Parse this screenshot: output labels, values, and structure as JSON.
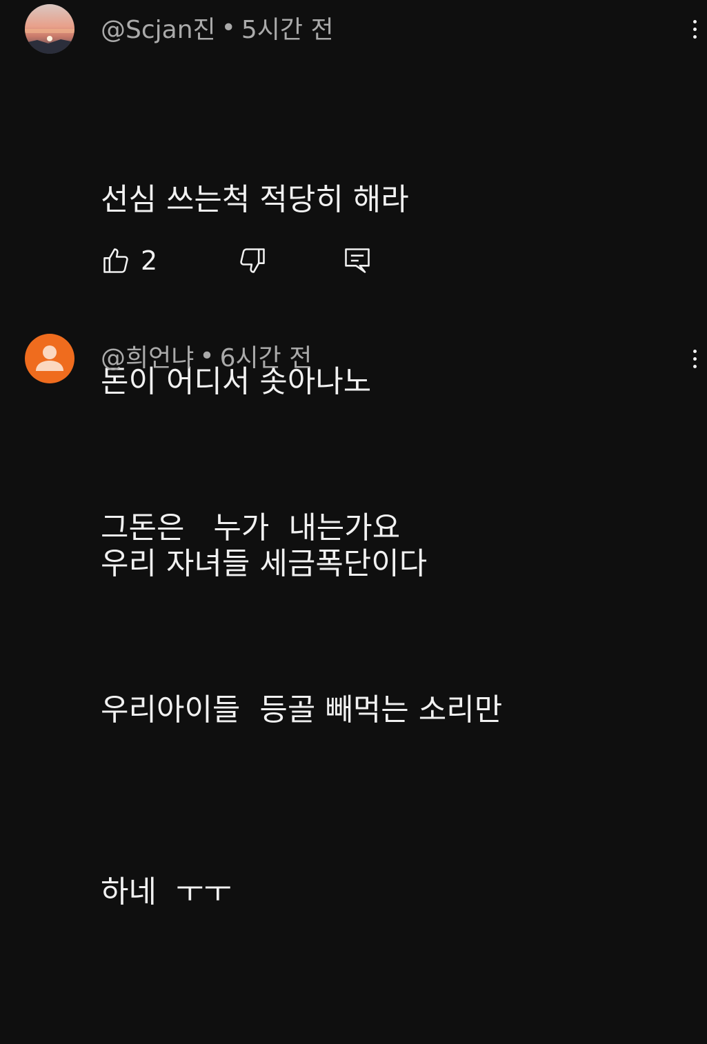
{
  "comments": [
    {
      "author": "@Scjan진",
      "separator": "•",
      "time": "5시간 전",
      "lines": [
        "선심 쓰는척 적당히 해라",
        "돈이 어디서 솟아나노",
        "우리 자녀들 세금폭단이다"
      ],
      "like_count": "2",
      "avatar": "sunset-avatar",
      "icons": [
        "thumbs-up-icon",
        "thumbs-down-icon",
        "reply-icon",
        "more-vert-icon"
      ]
    },
    {
      "author": "@희언냐",
      "separator": "•",
      "time": "6시간 전",
      "lines": [
        "그돈은   누가  내는가요",
        "우리아이들  등골 빼먹는 소리만",
        "하네  ㅜㅜ"
      ],
      "avatar": "default-user-avatar",
      "avatar_color": "#ef6c1e",
      "icons": [
        "more-vert-icon"
      ]
    }
  ]
}
